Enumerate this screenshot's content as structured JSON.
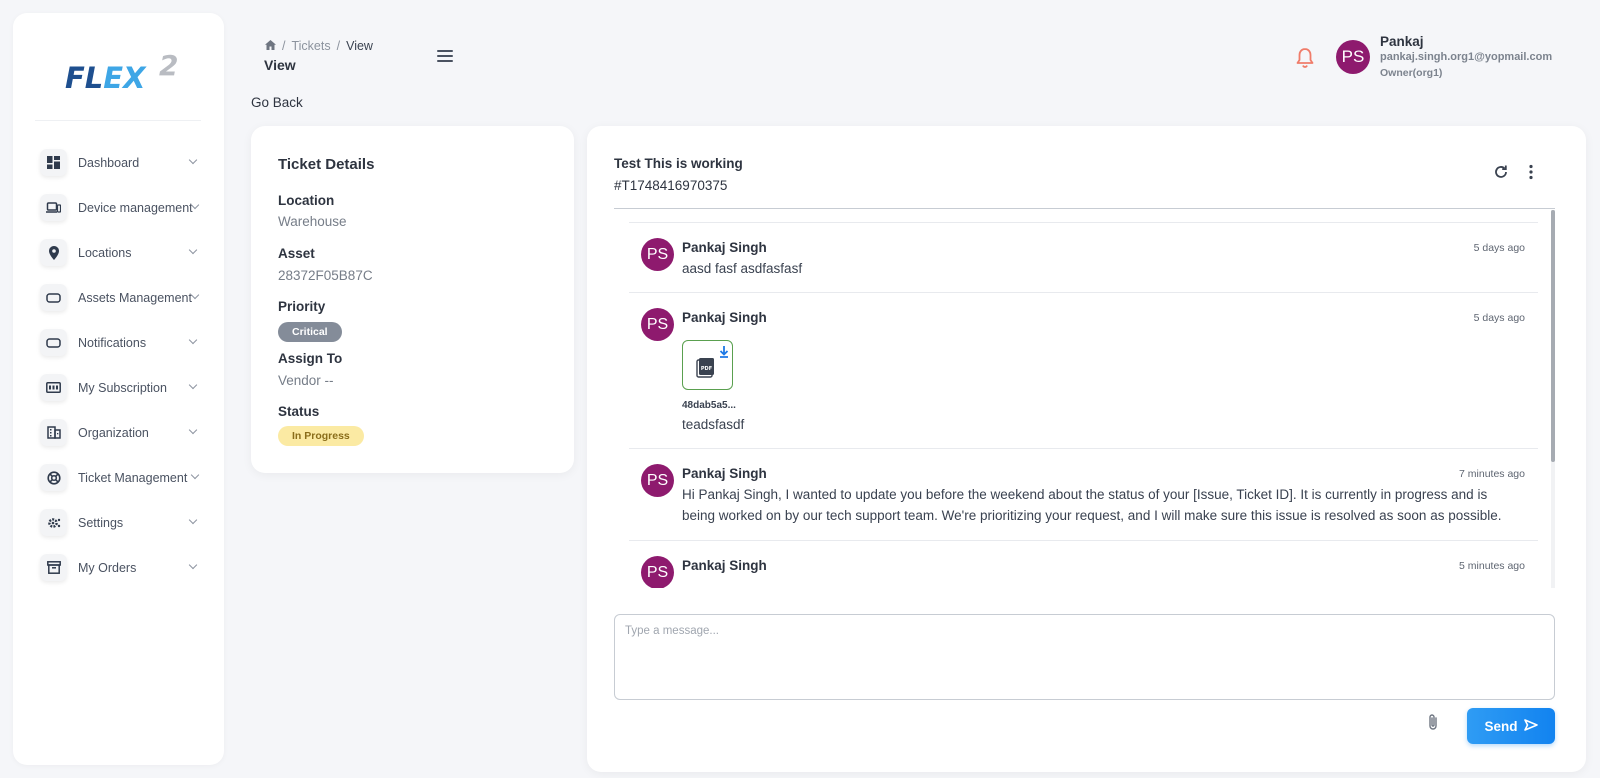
{
  "logo": {
    "text_main_1": "FL",
    "text_main_2": "E",
    "text_main_3": "X",
    "sup": "2"
  },
  "sidebar": {
    "items": [
      {
        "label": "Dashboard",
        "icon": "dashboard-icon"
      },
      {
        "label": "Device management",
        "icon": "laptop-icon"
      },
      {
        "label": "Locations",
        "icon": "location-pin-icon"
      },
      {
        "label": "Assets Management",
        "icon": "asset-icon"
      },
      {
        "label": "Notifications",
        "icon": "notification-box-icon"
      },
      {
        "label": "My Subscription",
        "icon": "subscription-icon"
      },
      {
        "label": "Organization",
        "icon": "building-icon"
      },
      {
        "label": "Ticket Management",
        "icon": "support-icon"
      },
      {
        "label": "Settings",
        "icon": "gear-icon"
      },
      {
        "label": "My Orders",
        "icon": "archive-box-icon"
      }
    ]
  },
  "header": {
    "breadcrumb": {
      "home_icon": "home-icon",
      "sep": "/",
      "item1": "Tickets",
      "item2": "View"
    },
    "title": "View",
    "go_back": "Go Back"
  },
  "user": {
    "initials": "PS",
    "name": "Pankaj",
    "email": "pankaj.singh.org1@yopmail.com",
    "role": "Owner(org1)"
  },
  "ticket": {
    "heading": "Ticket Details",
    "location_label": "Location",
    "location_value": "Warehouse",
    "asset_label": "Asset",
    "asset_value": "28372F05B87C",
    "priority_label": "Priority",
    "priority_value": "Critical",
    "assign_label": "Assign To",
    "assign_value": "Vendor --",
    "status_label": "Status",
    "status_value": "In Progress"
  },
  "chat": {
    "title": "Test This is working",
    "ticket_id": "#T1748416970375",
    "messages": [
      {
        "initials": "PS",
        "author": "Pankaj Singh",
        "time": "5 days ago",
        "text": "aasd fasf asdfasfasf"
      },
      {
        "initials": "PS",
        "author": "Pankaj Singh",
        "time": "5 days ago",
        "attachment": "48dab5a5...",
        "text": "teadsfasdf"
      },
      {
        "initials": "PS",
        "author": "Pankaj Singh",
        "time": "7 minutes ago",
        "text": "Hi Pankaj Singh, I wanted to update you before the weekend about the status of your [Issue, Ticket ID]. It is currently in progress and is being worked on by our tech support team. We're prioritizing your request, and I will make sure this issue is resolved as soon as possible."
      },
      {
        "initials": "PS",
        "author": "Pankaj Singh",
        "time": "5 minutes ago",
        "text": ""
      }
    ],
    "input_placeholder": "Type a message...",
    "send_label": "Send"
  },
  "colors": {
    "avatar": "#8e1a6e",
    "send": "#1283f0",
    "brand": "#1e4f8f",
    "bell": "#f07c6a"
  }
}
